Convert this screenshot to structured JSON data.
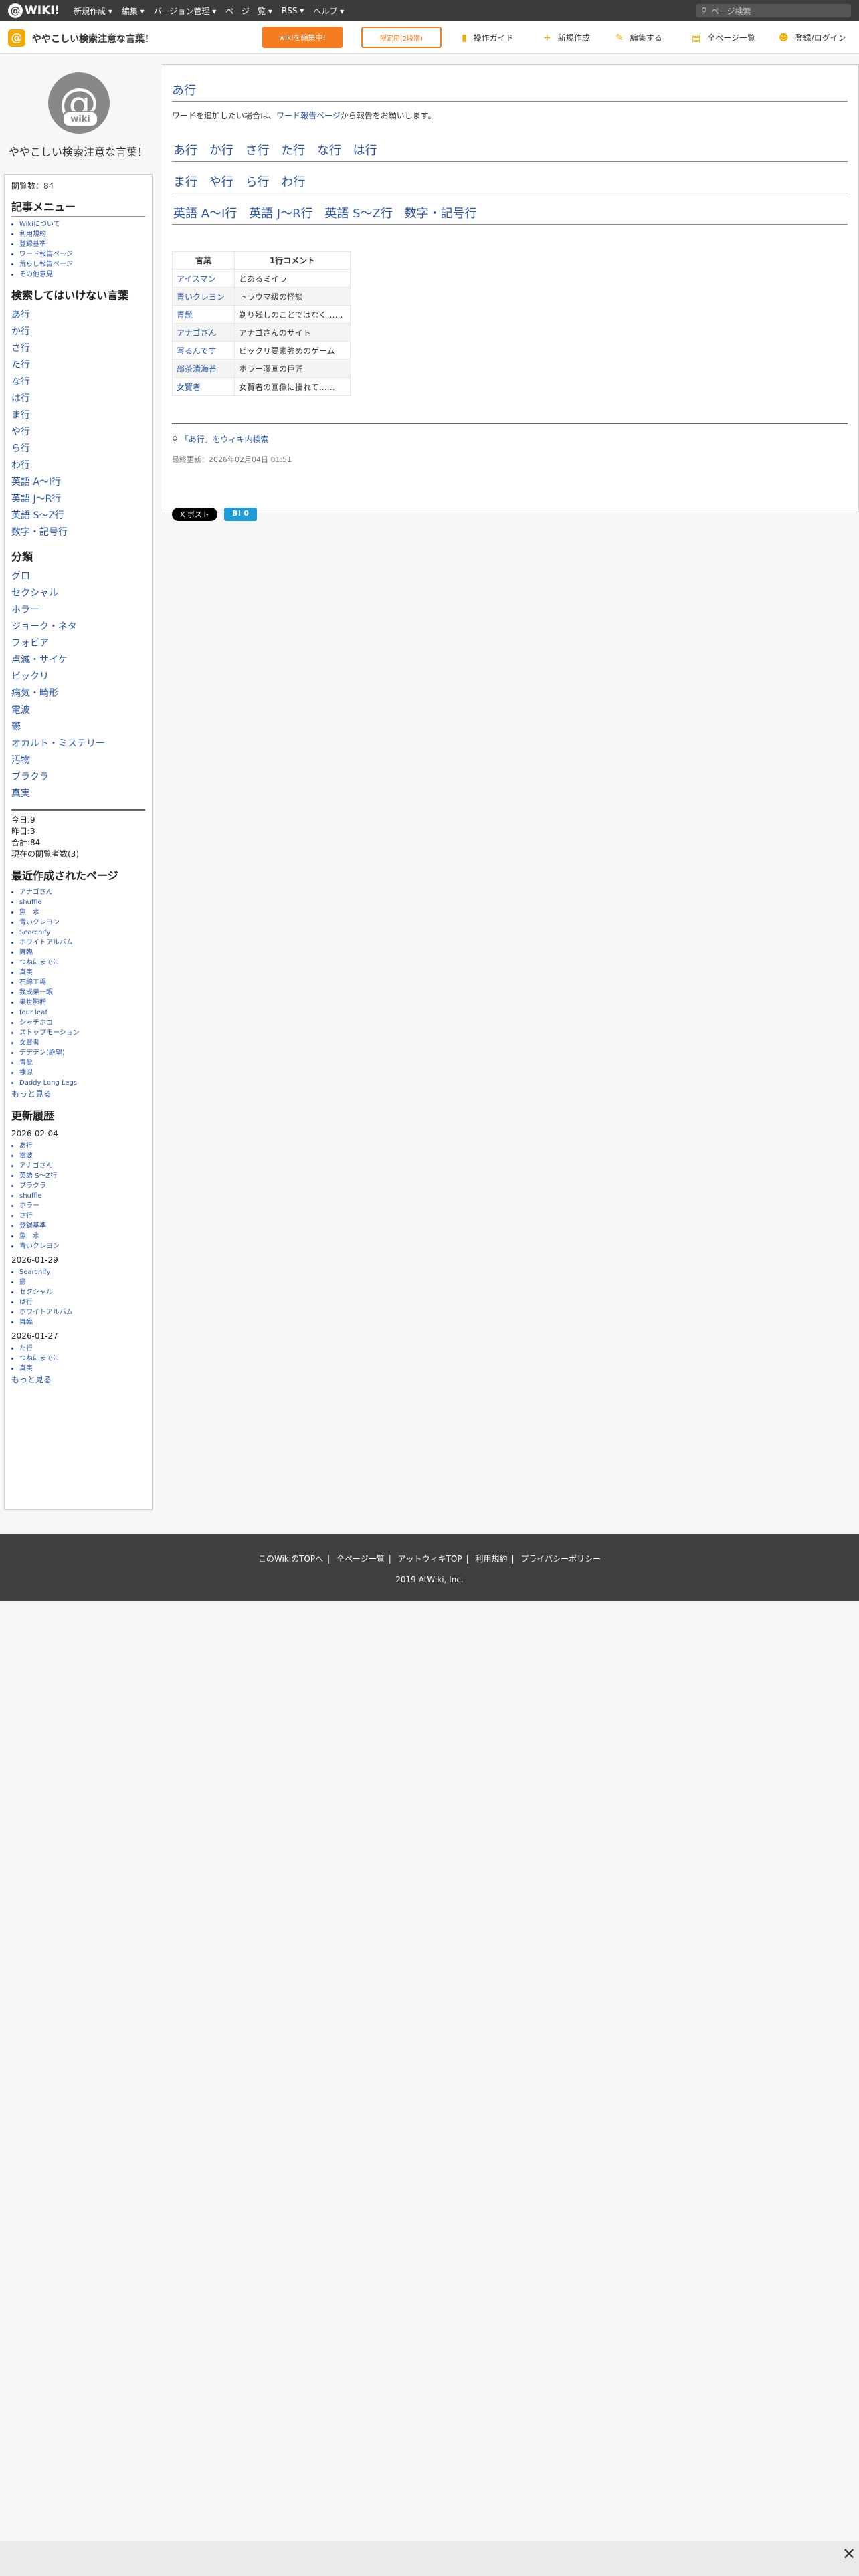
{
  "topbar": {
    "logo": "WIKI!",
    "menu": [
      "新規作成 ▾",
      "編集 ▾",
      "バージョン管理 ▾",
      "ページ一覧 ▾",
      "RSS ▾",
      "ヘルプ ▾"
    ],
    "search_placeholder": "ページ検索"
  },
  "header": {
    "site_name": "ややこしい検索注意な言葉！",
    "edit_button": "wikiを編集中!",
    "security_button": "限定用(2段階)",
    "nav": [
      "操作ガイド",
      "新規作成",
      "編集する",
      "全ページ一覧",
      "登録/ログイン"
    ]
  },
  "sidebar": {
    "site_title": "ややこしい検索注意な言葉！",
    "page_views": "閲覧数：84",
    "menu_title": "記事メニュー",
    "menu_items": [
      "Wikiについて",
      "利用規約",
      "登録基準",
      "ワード報告ページ",
      "荒らし報告ページ",
      "その他意見"
    ],
    "words_title": "検索してはいけない言葉",
    "word_items": [
      "あ行",
      "か行",
      "さ行",
      "た行",
      "な行",
      "は行",
      "ま行",
      "や行",
      "ら行",
      "わ行",
      "英語 A〜I行",
      "英語 J〜R行",
      "英語 S〜Z行",
      "数字・記号行"
    ],
    "category_title": "分類",
    "category_items": [
      "グロ",
      "セクシャル",
      "ホラー",
      "ジョーク・ネタ",
      "フォビア",
      "点滅・サイケ",
      "ビックリ",
      "病気・畸形",
      "電波",
      "鬱",
      "オカルト・ミステリー",
      "汚物",
      "ブラクラ",
      "真実"
    ],
    "counter": [
      "今日:9",
      "昨日:3",
      "合計:84",
      "現在の閲覧者数(3)"
    ],
    "recent_title": "最近作成されたページ",
    "recent_items": [
      "アナゴさん",
      "shuffle",
      "魚　水",
      "青いクレヨン",
      "Searchify",
      "ホワイトアルバム",
      "舞臨",
      "つねにまでに",
      "真実",
      "石綿工場",
      "我成果一眼",
      "果世影断",
      "four leaf",
      "シャチホコ",
      "ストップモーション",
      "女賢者",
      "デデデン(絶望)",
      "青髭",
      "裸児",
      "Daddy Long Legs"
    ],
    "recent_more": "もっと見る",
    "history_title": "更新履歴",
    "history": [
      {
        "date": "2026-02-04",
        "items": [
          "あ行",
          "電波",
          "アナゴさん",
          "英語 S〜Z行",
          "ブラクラ",
          "shuffle",
          "ホラー",
          "さ行",
          "登録基準",
          "魚　水",
          "青いクレヨン"
        ]
      },
      {
        "date": "2026-01-29",
        "items": [
          "Searchify",
          "鬱",
          "セクシャル",
          "は行",
          "ホワイトアルバム",
          "舞臨"
        ]
      },
      {
        "date": "2026-01-27",
        "items": [
          "た行",
          "つねにまでに",
          "真実"
        ]
      }
    ],
    "history_more": "もっと見る"
  },
  "main": {
    "title": "あ行",
    "intro_prefix": "ワードを追加したい場合は、",
    "intro_link": "ワード報告ページ",
    "intro_suffix": "から報告をお願いします。",
    "nav_rows": [
      [
        "あ行",
        "か行",
        "さ行",
        "た行",
        "な行",
        "は行"
      ],
      [
        "ま行",
        "や行",
        "ら行",
        "わ行"
      ],
      [
        "英語 A〜I行",
        "英語 J〜R行",
        "英語 S〜Z行",
        "数字・記号行"
      ]
    ],
    "table": {
      "headers": [
        "言葉",
        "1行コメント"
      ],
      "rows": [
        [
          "アイスマン",
          "とあるミイラ"
        ],
        [
          "青いクレヨン",
          "トラウマ級の怪談"
        ],
        [
          "青髭",
          "剃り残しのことではなく……"
        ],
        [
          "アナゴさん",
          "アナゴさんのサイト"
        ],
        [
          "写るんです",
          "ビックリ要素強めのゲーム"
        ],
        [
          "部茶漬海苔",
          "ホラー漫画の巨匠"
        ],
        [
          "女賢者",
          "女賢者の画像に掛れて……"
        ]
      ]
    },
    "search_link": "「あ行」をウィキ内検索",
    "last_updated": "最終更新：2026年02月04日 01:51",
    "share_x": "X ポスト",
    "share_b": "B! 0"
  },
  "footer": {
    "links": [
      "このWikiのTOPへ",
      "全ページ一覧",
      "アットウィキTOP",
      "利用規約",
      "プライバシーポリシー"
    ],
    "copyright": "2019 AtWiki, Inc."
  },
  "colors": {
    "accent": "#f57c20",
    "link": "#2a56a8",
    "topbar": "#3b3b3b"
  }
}
